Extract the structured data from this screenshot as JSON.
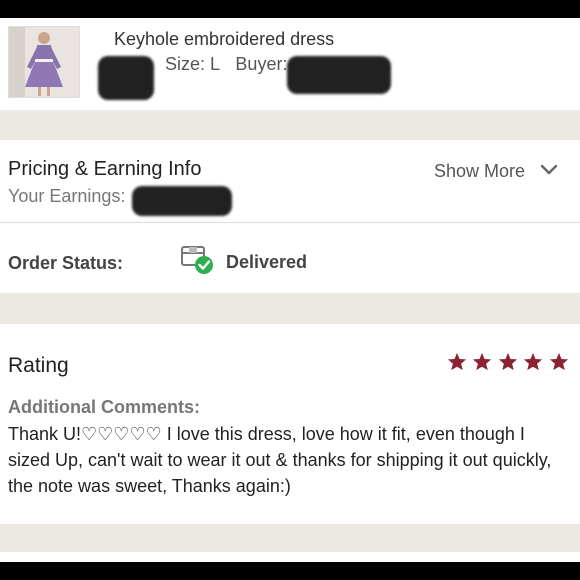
{
  "item": {
    "title": "Keyhole embroidered dress",
    "size_text": "Size: L",
    "buyer_label": "Buyer:"
  },
  "pricing": {
    "title": "Pricing & Earning Info",
    "earnings_label": "Your Earnings:",
    "show_more": "Show More",
    "show_more_icon": "chevron-down-icon"
  },
  "order": {
    "status_label": "Order Status:",
    "status_value": "Delivered",
    "status_icon": "delivered-box-icon"
  },
  "rating": {
    "title": "Rating",
    "stars": 5,
    "star_color": "#8b2332",
    "comments_label": "Additional Comments:",
    "comments": "Thank U!♡♡♡♡♡ I love this dress, love how it fit, even though I sized Up, can't wait to wear it out & thanks for shipping it out quickly, the note was sweet, Thanks again:)"
  },
  "colors": {
    "background": "#ece9e5",
    "card": "#ffffff",
    "delivered_check": "#2eae4f"
  }
}
